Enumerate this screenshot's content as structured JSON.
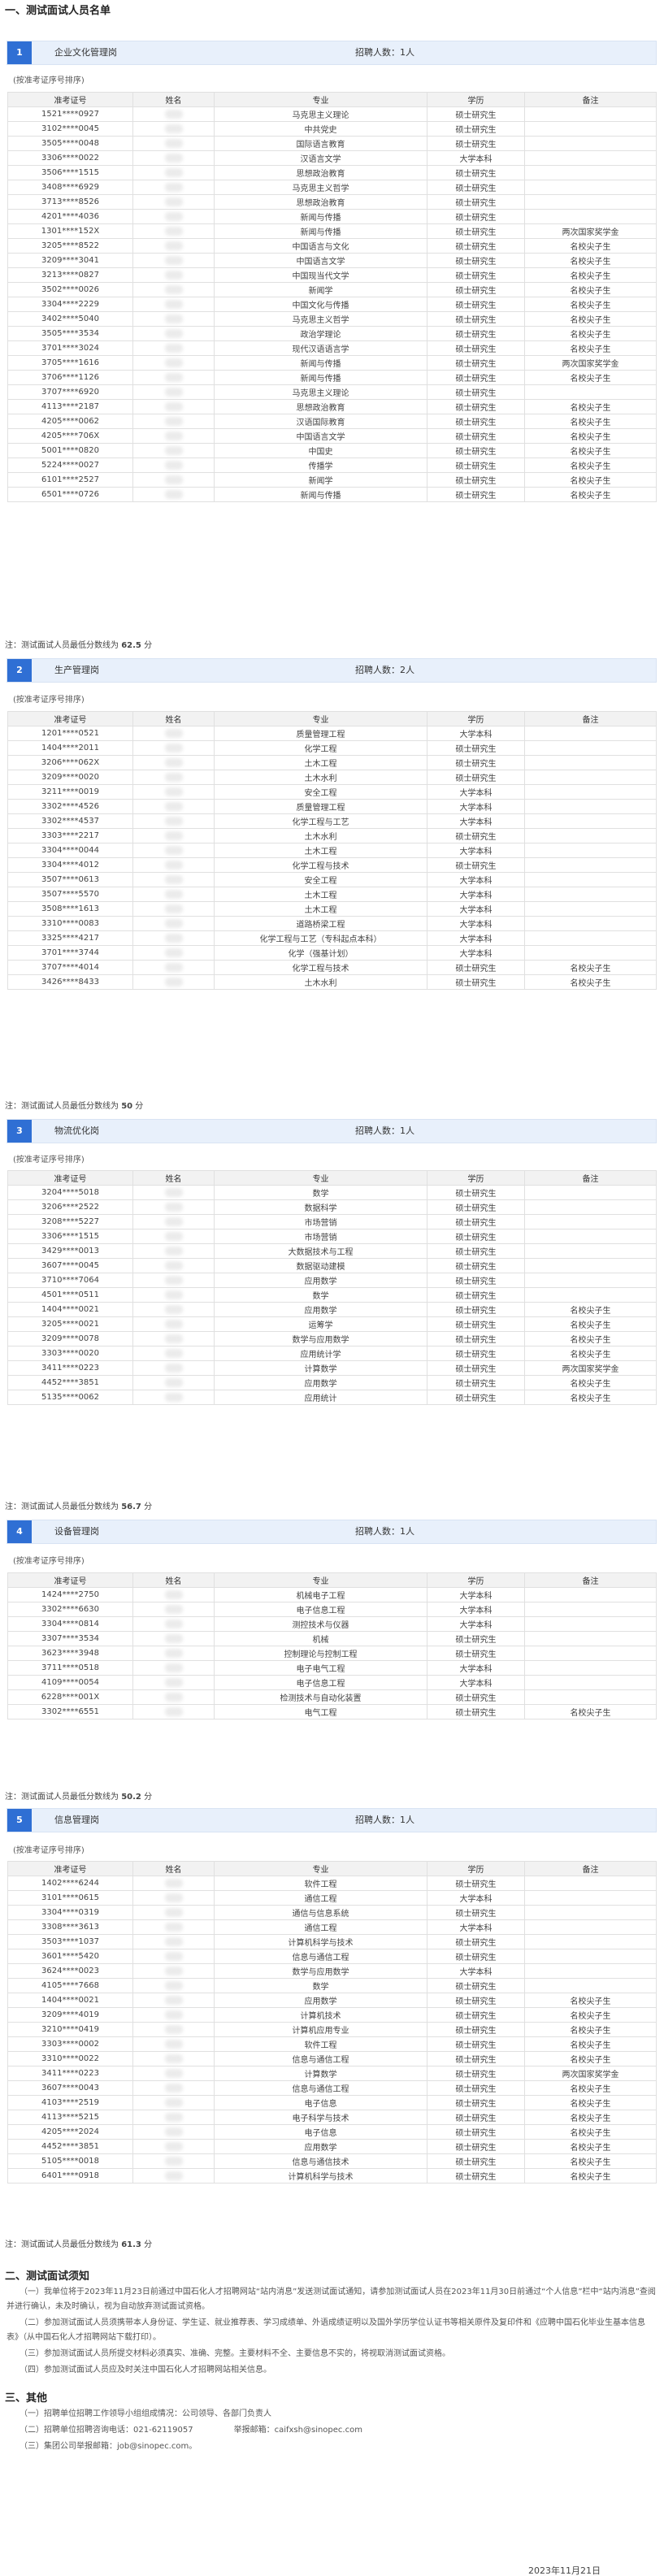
{
  "section1": {
    "title": "一、测试面试人员名单"
  },
  "hint": "(按准考证序号排序)",
  "headers": {
    "ticket": "准考证号",
    "name": "姓名",
    "major": "专业",
    "edu": "学历",
    "remark": "备注"
  },
  "note_prefix": "注：测试面试人员最低分数线为",
  "note_suffix": "分",
  "posts": [
    {
      "num": "1",
      "name": "企业文化管理岗",
      "count": "招聘人数：1人",
      "cutoff": "62.5",
      "rows": [
        [
          "1521****0927",
          "马克思主义理论",
          "硕士研究生",
          ""
        ],
        [
          "3102****0045",
          "中共党史",
          "硕士研究生",
          ""
        ],
        [
          "3505****0048",
          "国际语言教育",
          "硕士研究生",
          ""
        ],
        [
          "3306****0022",
          "汉语言文学",
          "大学本科",
          ""
        ],
        [
          "3506****1515",
          "思想政治教育",
          "硕士研究生",
          ""
        ],
        [
          "3408****6929",
          "马克思主义哲学",
          "硕士研究生",
          ""
        ],
        [
          "3713****8526",
          "思想政治教育",
          "硕士研究生",
          ""
        ],
        [
          "4201****4036",
          "新闻与传播",
          "硕士研究生",
          ""
        ],
        [
          "1301****152X",
          "新闻与传播",
          "硕士研究生",
          "两次国家奖学金"
        ],
        [
          "3205****8522",
          "中国语言与文化",
          "硕士研究生",
          "名校尖子生"
        ],
        [
          "3209****3041",
          "中国语言文学",
          "硕士研究生",
          "名校尖子生"
        ],
        [
          "3213****0827",
          "中国现当代文学",
          "硕士研究生",
          "名校尖子生"
        ],
        [
          "3502****0026",
          "新闻学",
          "硕士研究生",
          "名校尖子生"
        ],
        [
          "3304****2229",
          "中国文化与传播",
          "硕士研究生",
          "名校尖子生"
        ],
        [
          "3402****5040",
          "马克思主义哲学",
          "硕士研究生",
          "名校尖子生"
        ],
        [
          "3505****3534",
          "政治学理论",
          "硕士研究生",
          "名校尖子生"
        ],
        [
          "3701****3024",
          "现代汉语语言学",
          "硕士研究生",
          "名校尖子生"
        ],
        [
          "3705****1616",
          "新闻与传播",
          "硕士研究生",
          "两次国家奖学金"
        ],
        [
          "3706****1126",
          "新闻与传播",
          "硕士研究生",
          "名校尖子生"
        ],
        [
          "3707****6920",
          "马克思主义理论",
          "硕士研究生",
          ""
        ],
        [
          "4113****2187",
          "思想政治教育",
          "硕士研究生",
          "名校尖子生"
        ],
        [
          "4205****0062",
          "汉语国际教育",
          "硕士研究生",
          "名校尖子生"
        ],
        [
          "4205****706X",
          "中国语言文学",
          "硕士研究生",
          "名校尖子生"
        ],
        [
          "5001****0820",
          "中国史",
          "硕士研究生",
          "名校尖子生"
        ],
        [
          "5224****0027",
          "传播学",
          "硕士研究生",
          "名校尖子生"
        ],
        [
          "6101****2527",
          "新闻学",
          "硕士研究生",
          "名校尖子生"
        ],
        [
          "6501****0726",
          "新闻与传播",
          "硕士研究生",
          "名校尖子生"
        ]
      ]
    },
    {
      "num": "2",
      "name": "生产管理岗",
      "count": "招聘人数：2人",
      "cutoff": "50",
      "rows": [
        [
          "1201****0521",
          "质量管理工程",
          "大学本科",
          ""
        ],
        [
          "1404****2011",
          "化学工程",
          "硕士研究生",
          ""
        ],
        [
          "3206****062X",
          "土木工程",
          "硕士研究生",
          ""
        ],
        [
          "3209****0020",
          "土木水利",
          "硕士研究生",
          ""
        ],
        [
          "3211****0019",
          "安全工程",
          "大学本科",
          ""
        ],
        [
          "3302****4526",
          "质量管理工程",
          "大学本科",
          ""
        ],
        [
          "3302****4537",
          "化学工程与工艺",
          "大学本科",
          ""
        ],
        [
          "3303****2217",
          "土木水利",
          "硕士研究生",
          ""
        ],
        [
          "3304****0044",
          "土木工程",
          "大学本科",
          ""
        ],
        [
          "3304****4012",
          "化学工程与技术",
          "硕士研究生",
          ""
        ],
        [
          "3507****0613",
          "安全工程",
          "大学本科",
          ""
        ],
        [
          "3507****5570",
          "土木工程",
          "大学本科",
          ""
        ],
        [
          "3508****1613",
          "土木工程",
          "大学本科",
          ""
        ],
        [
          "3310****0083",
          "道路桥梁工程",
          "大学本科",
          ""
        ],
        [
          "3325****4217",
          "化学工程与工艺（专科起点本科）",
          "大学本科",
          ""
        ],
        [
          "3701****3744",
          "化学（强基计划）",
          "大学本科",
          ""
        ],
        [
          "3707****4014",
          "化学工程与技术",
          "硕士研究生",
          "名校尖子生"
        ],
        [
          "3426****8433",
          "土木水利",
          "硕士研究生",
          "名校尖子生"
        ]
      ]
    },
    {
      "num": "3",
      "name": "物流优化岗",
      "count": "招聘人数：1人",
      "cutoff": "56.7",
      "rows": [
        [
          "3204****5018",
          "数学",
          "硕士研究生",
          ""
        ],
        [
          "3206****2522",
          "数据科学",
          "硕士研究生",
          ""
        ],
        [
          "3208****5227",
          "市场营销",
          "硕士研究生",
          ""
        ],
        [
          "3306****1515",
          "市场营销",
          "硕士研究生",
          ""
        ],
        [
          "3429****0013",
          "大数据技术与工程",
          "硕士研究生",
          ""
        ],
        [
          "3607****0045",
          "数据驱动建模",
          "硕士研究生",
          ""
        ],
        [
          "3710****7064",
          "应用数学",
          "硕士研究生",
          ""
        ],
        [
          "4501****0511",
          "数学",
          "硕士研究生",
          ""
        ],
        [
          "1404****0021",
          "应用数学",
          "硕士研究生",
          "名校尖子生"
        ],
        [
          "3205****0021",
          "运筹学",
          "硕士研究生",
          "名校尖子生"
        ],
        [
          "3209****0078",
          "数学与应用数学",
          "硕士研究生",
          "名校尖子生"
        ],
        [
          "3303****0020",
          "应用统计学",
          "硕士研究生",
          "名校尖子生"
        ],
        [
          "3411****0223",
          "计算数学",
          "硕士研究生",
          "两次国家奖学金"
        ],
        [
          "4452****3851",
          "应用数学",
          "硕士研究生",
          "名校尖子生"
        ],
        [
          "5135****0062",
          "应用统计",
          "硕士研究生",
          "名校尖子生"
        ]
      ]
    },
    {
      "num": "4",
      "name": "设备管理岗",
      "count": "招聘人数：1人",
      "cutoff": "50.2",
      "rows": [
        [
          "1424****2750",
          "机械电子工程",
          "大学本科",
          ""
        ],
        [
          "3302****6630",
          "电子信息工程",
          "大学本科",
          ""
        ],
        [
          "3304****0814",
          "测控技术与仪器",
          "大学本科",
          ""
        ],
        [
          "3307****3534",
          "机械",
          "硕士研究生",
          ""
        ],
        [
          "3623****3948",
          "控制理论与控制工程",
          "硕士研究生",
          ""
        ],
        [
          "3711****0518",
          "电子电气工程",
          "大学本科",
          ""
        ],
        [
          "4109****0054",
          "电子信息工程",
          "大学本科",
          ""
        ],
        [
          "6228****001X",
          "检测技术与自动化装置",
          "硕士研究生",
          ""
        ],
        [
          "3302****6551",
          "电气工程",
          "硕士研究生",
          "名校尖子生"
        ]
      ]
    },
    {
      "num": "5",
      "name": "信息管理岗",
      "count": "招聘人数：1人",
      "cutoff": "61.3",
      "rows": [
        [
          "1402****6244",
          "软件工程",
          "硕士研究生",
          ""
        ],
        [
          "3101****0615",
          "通信工程",
          "大学本科",
          ""
        ],
        [
          "3304****0319",
          "通信与信息系统",
          "硕士研究生",
          ""
        ],
        [
          "3308****3613",
          "通信工程",
          "大学本科",
          ""
        ],
        [
          "3503****1037",
          "计算机科学与技术",
          "硕士研究生",
          ""
        ],
        [
          "3601****5420",
          "信息与通信工程",
          "硕士研究生",
          ""
        ],
        [
          "3624****0023",
          "数学与应用数学",
          "大学本科",
          ""
        ],
        [
          "4105****7668",
          "数学",
          "硕士研究生",
          ""
        ],
        [
          "1404****0021",
          "应用数学",
          "硕士研究生",
          "名校尖子生"
        ],
        [
          "3209****4019",
          "计算机技术",
          "硕士研究生",
          "名校尖子生"
        ],
        [
          "3210****0419",
          "计算机应用专业",
          "硕士研究生",
          "名校尖子生"
        ],
        [
          "3303****0002",
          "软件工程",
          "硕士研究生",
          "名校尖子生"
        ],
        [
          "3310****0022",
          "信息与通信工程",
          "硕士研究生",
          "名校尖子生"
        ],
        [
          "3411****0223",
          "计算数学",
          "硕士研究生",
          "两次国家奖学金"
        ],
        [
          "3607****0043",
          "信息与通信工程",
          "硕士研究生",
          "名校尖子生"
        ],
        [
          "4103****2519",
          "电子信息",
          "硕士研究生",
          "名校尖子生"
        ],
        [
          "4113****5215",
          "电子科学与技术",
          "硕士研究生",
          "名校尖子生"
        ],
        [
          "4205****2024",
          "电子信息",
          "硕士研究生",
          "名校尖子生"
        ],
        [
          "4452****3851",
          "应用数学",
          "硕士研究生",
          "名校尖子生"
        ],
        [
          "5105****0018",
          "信息与通信技术",
          "硕士研究生",
          "名校尖子生"
        ],
        [
          "6401****0918",
          "计算机科学与技术",
          "硕士研究生",
          "名校尖子生"
        ]
      ]
    }
  ],
  "section2": {
    "title": "二、测试面试须知",
    "p1": "（一）我单位将于2023年11月23日前通过中国石化人才招聘网站“站内消息”发送测试面试通知，请参加测试面试人员在2023年11月30日前通过“个人信息”栏中“站内消息”查阅并进行确认，未及时确认，视为自动放弃测试面试资格。",
    "p2": "（二）参加测试面试人员须携带本人身份证、学生证、就业推荐表、学习成绩单、外语成绩证明以及国外学历学位认证书等相关原件及复印件和《应聘中国石化毕业生基本信息表》（从中国石化人才招聘网站下载打印）。",
    "p3": "（三）参加测试面试人员所提交材料必须真实、准确、完整。主要材料不全、主要信息不实的，将视取消测试面试资格。",
    "p4": "（四）参加测试面试人员应及时关注中国石化人才招聘网站相关信息。"
  },
  "section3": {
    "title": "三、其他",
    "item1": "（一）招聘单位招聘工作领导小组组成情况：公司领导、各部门负责人",
    "item2": "（二）招聘单位招聘咨询电话：021-62119057　　　　　举报邮箱：caifxsh@sinopec.com",
    "item3": "（三）集团公司举报邮箱：job@sinopec.com。"
  },
  "date": "2023年11月21日"
}
